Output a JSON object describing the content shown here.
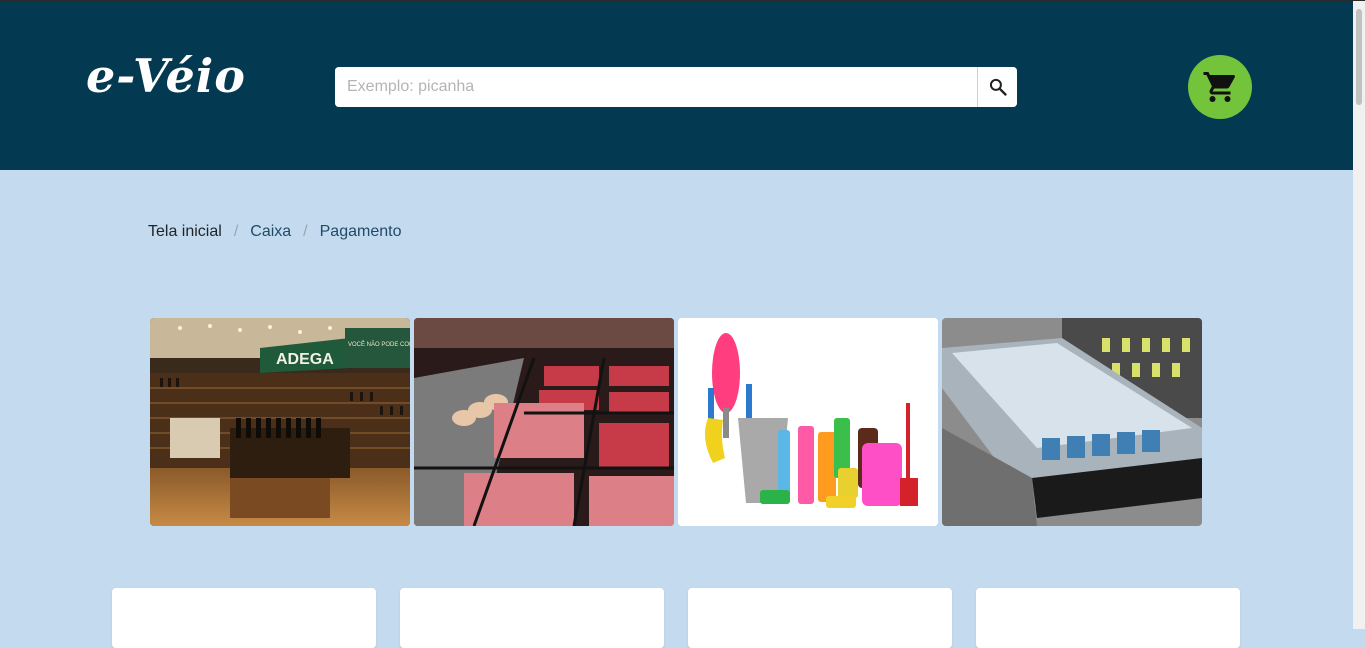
{
  "header": {
    "logo_text": "e-Véio",
    "search": {
      "placeholder": "Exemplo: picanha",
      "value": ""
    },
    "search_button_icon": "search-icon",
    "cart_button_icon": "cart-icon",
    "colors": {
      "header_bg": "#033a51",
      "cart_bg": "#74c43b",
      "page_bg": "#c4dbef"
    }
  },
  "breadcrumb": {
    "items": [
      "Tela inicial",
      "Caixa",
      "Pagamento"
    ],
    "separator": "/"
  },
  "categories": [
    {
      "image": "wine-cellar-photo",
      "sign_text": "ADEGA",
      "slogan_text": "VOCÊ NÃO PODE COMPRAR UM"
    },
    {
      "image": "meat-counter-photo"
    },
    {
      "image": "cleaning-products-photo"
    },
    {
      "image": "frozen-foods-photo"
    }
  ],
  "product_cards": [
    {},
    {},
    {},
    {}
  ]
}
